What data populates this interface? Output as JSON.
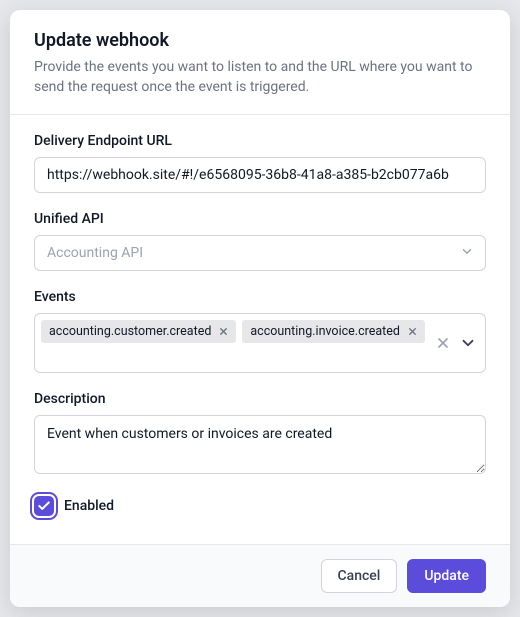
{
  "header": {
    "title": "Update webhook",
    "subtitle": "Provide the events you want to listen to and the URL where you want to send the request once the event is triggered."
  },
  "fields": {
    "delivery_url": {
      "label": "Delivery Endpoint URL",
      "value": "https://webhook.site/#!/e6568095-36b8-41a8-a385-b2cb077a6b"
    },
    "unified_api": {
      "label": "Unified API",
      "value": "Accounting API"
    },
    "events": {
      "label": "Events",
      "selected": [
        "accounting.customer.created",
        "accounting.invoice.created"
      ]
    },
    "description": {
      "label": "Description",
      "value": "Event when customers or invoices are created"
    },
    "enabled": {
      "label": "Enabled",
      "checked": true
    }
  },
  "footer": {
    "cancel": "Cancel",
    "update": "Update"
  }
}
